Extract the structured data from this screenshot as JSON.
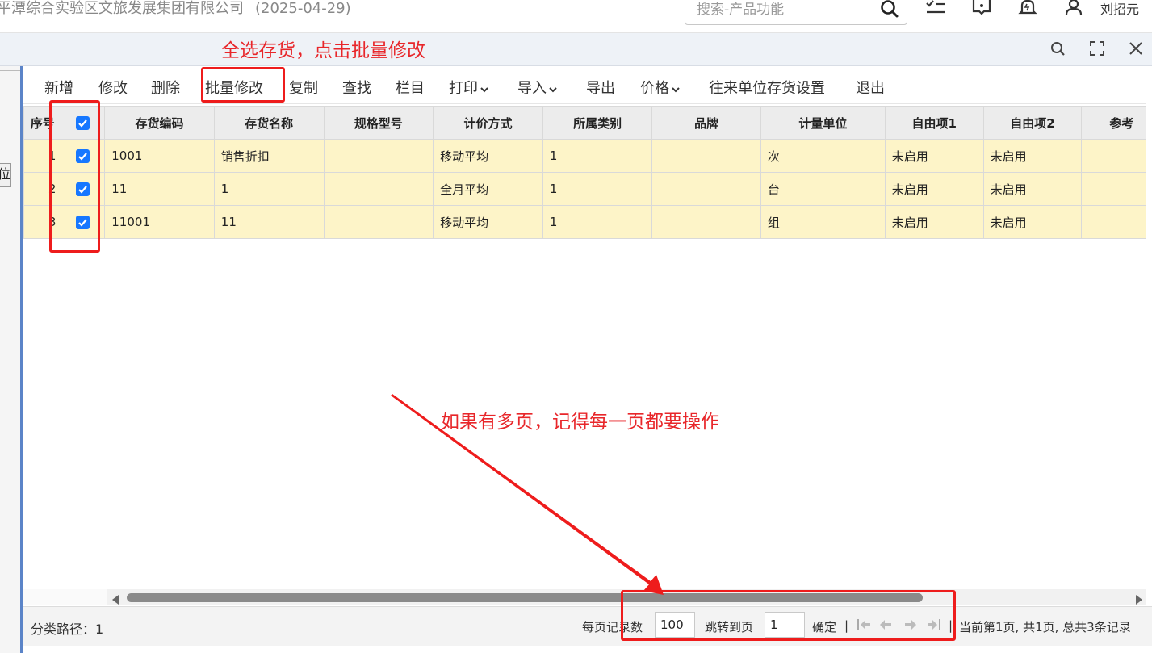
{
  "header": {
    "company": "平潭综合实验区文旅发展集团有限公司",
    "date": "(2025-04-29)",
    "search_placeholder": "搜索-产品功能",
    "username": "刘招元"
  },
  "annotations": {
    "top": "全选存货，点击批量修改",
    "middle": "如果有多页，记得每一页都要操作"
  },
  "sidebar": {
    "button_label": "位"
  },
  "toolbar": {
    "items": [
      "新增",
      "修改",
      "删除",
      "批量修改",
      "复制",
      "查找",
      "栏目",
      "打印",
      "导入",
      "导出",
      "价格",
      "往来单位存货设置",
      "退出"
    ]
  },
  "table": {
    "columns": [
      "序号",
      "",
      "存货编码",
      "存货名称",
      "规格型号",
      "计价方式",
      "所属类别",
      "品牌",
      "计量单位",
      "自由项1",
      "自由项2",
      "参考"
    ],
    "header_checked": true,
    "rows": [
      {
        "seq": "1",
        "checked": true,
        "code": "1001",
        "name": "销售折扣",
        "spec": "",
        "pricing": "移动平均",
        "category": "1",
        "brand": "",
        "unit": "次",
        "free1": "未启用",
        "free2": "未启用"
      },
      {
        "seq": "2",
        "checked": true,
        "code": "11",
        "name": "1",
        "spec": "",
        "pricing": "全月平均",
        "category": "1",
        "brand": "",
        "unit": "台",
        "free1": "未启用",
        "free2": "未启用"
      },
      {
        "seq": "3",
        "checked": true,
        "code": "11001",
        "name": "11",
        "spec": "",
        "pricing": "移动平均",
        "category": "1",
        "brand": "",
        "unit": "组",
        "free1": "未启用",
        "free2": "未启用"
      }
    ]
  },
  "footer": {
    "path_label": "分类路径：1",
    "per_page_label": "每页记录数",
    "per_page_value": "100",
    "goto_label": "跳转到页",
    "goto_value": "1",
    "confirm_label": "确定",
    "separator": "|",
    "status": "当前第1页, 共1页, 总共3条记录"
  },
  "colors": {
    "accent": "#1677ff",
    "annotation_red": "#e8262a",
    "row_highlight": "#fdf4c8"
  }
}
